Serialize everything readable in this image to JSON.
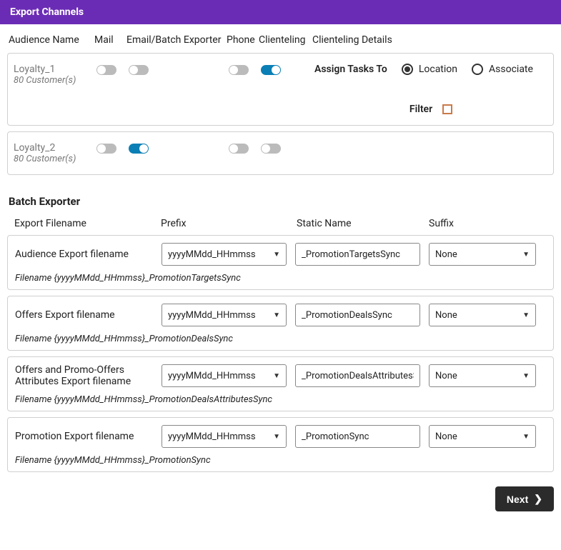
{
  "header": {
    "title": "Export Channels"
  },
  "columns": {
    "audience": "Audience Name",
    "mail": "Mail",
    "email": "Email/Batch Exporter",
    "phone": "Phone",
    "clienteling": "Clienteling",
    "clienteling_details": "Clienteling Details"
  },
  "details": {
    "assign_label": "Assign Tasks To",
    "option_location": "Location",
    "option_associate": "Associate",
    "filter_label": "Filter"
  },
  "audiences": [
    {
      "name": "Loyalty_1",
      "count": "80 Customer(s)",
      "toggles": {
        "mail": false,
        "email": false,
        "phone": false,
        "clienteling": true
      },
      "assign_selected": "location",
      "show_details": true
    },
    {
      "name": "Loyalty_2",
      "count": "80 Customer(s)",
      "toggles": {
        "mail": false,
        "email": true,
        "phone": false,
        "clienteling": false
      },
      "show_details": false
    }
  ],
  "batch": {
    "title": "Batch Exporter",
    "headers": {
      "export": "Export Filename",
      "prefix": "Prefix",
      "static": "Static Name",
      "suffix": "Suffix"
    },
    "rows": [
      {
        "label": "Audience Export filename",
        "prefix": "yyyyMMdd_HHmmss",
        "static": "_PromotionTargetsSync",
        "suffix": "None",
        "preview": "Filename {yyyyMMdd_HHmmss}_PromotionTargetsSync"
      },
      {
        "label": "Offers Export filename",
        "prefix": "yyyyMMdd_HHmmss",
        "static": "_PromotionDealsSync",
        "suffix": "None",
        "preview": "Filename {yyyyMMdd_HHmmss}_PromotionDealsSync"
      },
      {
        "label": "Offers and Promo-Offers Attributes Export filename",
        "prefix": "yyyyMMdd_HHmmss",
        "static": "_PromotionDealsAttributesSync",
        "suffix": "None",
        "preview": "Filename {yyyyMMdd_HHmmss}_PromotionDealsAttributesSync"
      },
      {
        "label": "Promotion Export filename",
        "prefix": "yyyyMMdd_HHmmss",
        "static": "_PromotionSync",
        "suffix": "None",
        "preview": "Filename {yyyyMMdd_HHmmss}_PromotionSync"
      }
    ]
  },
  "footer": {
    "next_label": "Next"
  }
}
